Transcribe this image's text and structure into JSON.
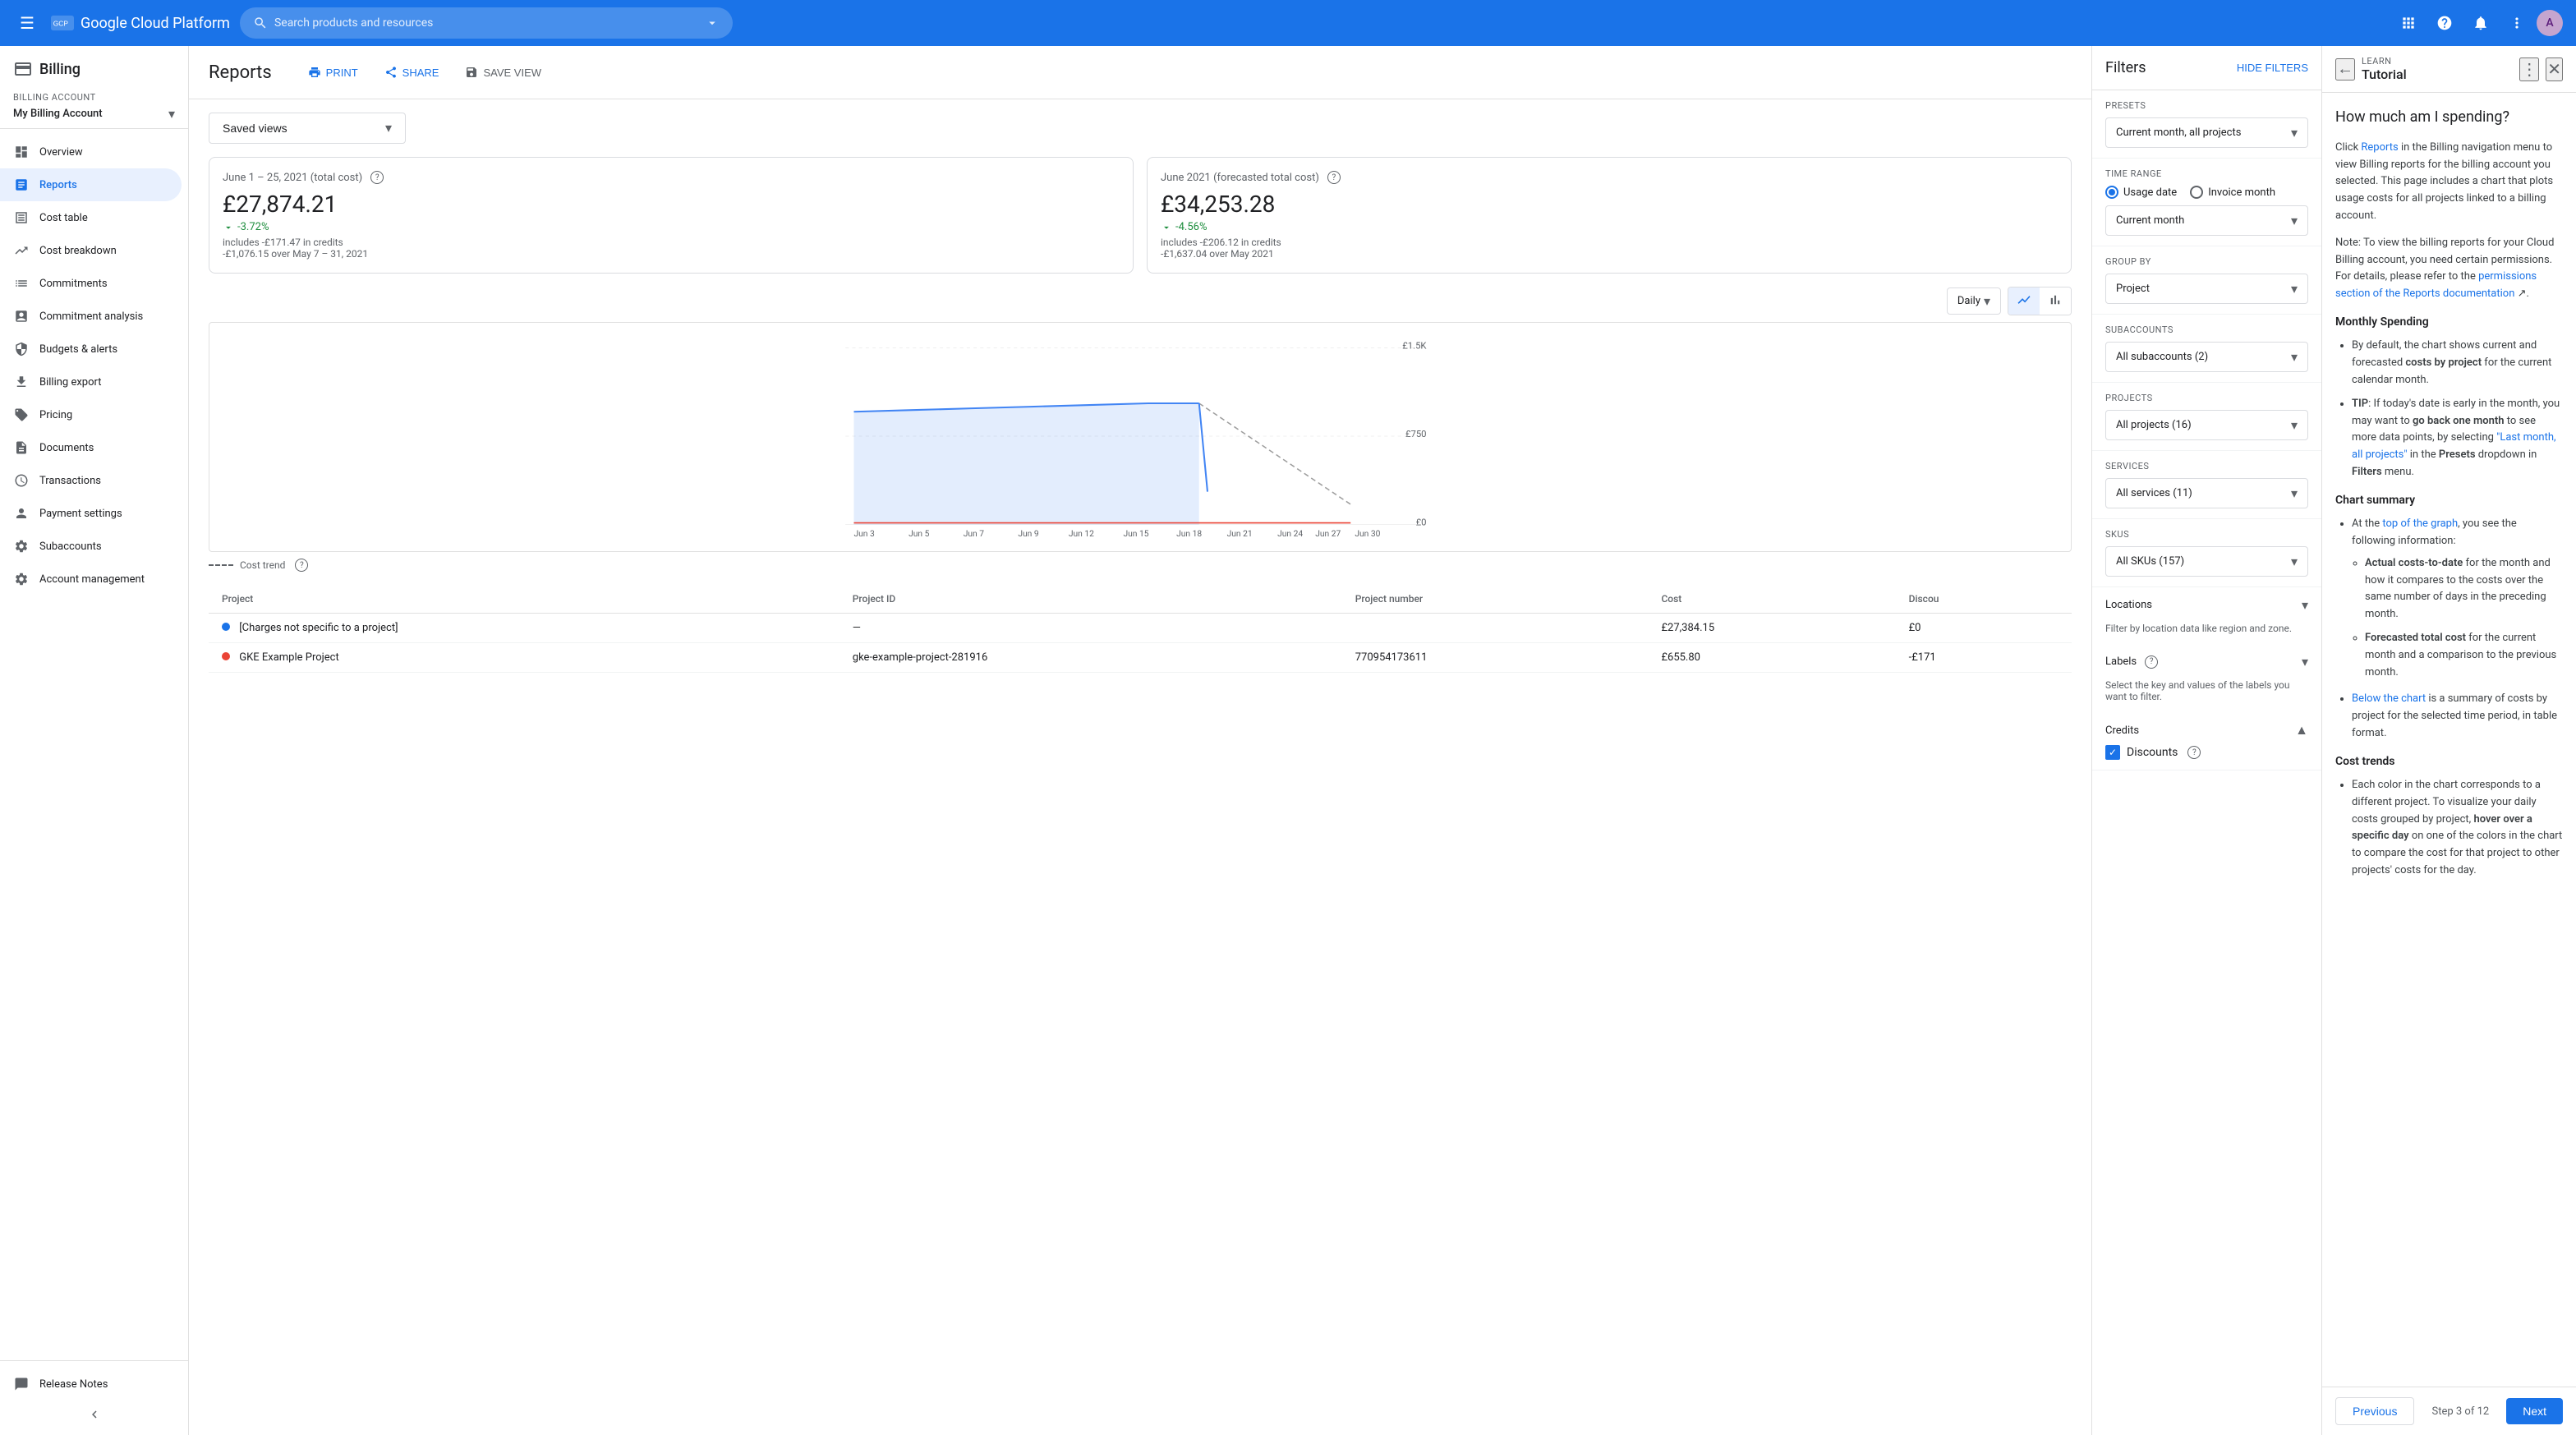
{
  "topnav": {
    "logo": "Google Cloud Platform",
    "search_placeholder": "Search products and resources"
  },
  "sidebar": {
    "billing_title": "Billing",
    "billing_account_label": "Billing account",
    "billing_account_name": "My Billing Account",
    "nav_items": [
      {
        "id": "overview",
        "label": "Overview",
        "icon": "⊞"
      },
      {
        "id": "reports",
        "label": "Reports",
        "icon": "📊",
        "active": true
      },
      {
        "id": "cost-table",
        "label": "Cost table",
        "icon": "⊟"
      },
      {
        "id": "cost-breakdown",
        "label": "Cost breakdown",
        "icon": "📉"
      },
      {
        "id": "commitments",
        "label": "Commitments",
        "icon": "≡"
      },
      {
        "id": "commitment-analysis",
        "label": "Commitment analysis",
        "icon": "📋"
      },
      {
        "id": "budgets-alerts",
        "label": "Budgets & alerts",
        "icon": "🔔"
      },
      {
        "id": "billing-export",
        "label": "Billing export",
        "icon": "⬆"
      },
      {
        "id": "pricing",
        "label": "Pricing",
        "icon": "🏷"
      },
      {
        "id": "documents",
        "label": "Documents",
        "icon": "📄"
      },
      {
        "id": "transactions",
        "label": "Transactions",
        "icon": "🕐"
      },
      {
        "id": "payment-settings",
        "label": "Payment settings",
        "icon": "👤"
      },
      {
        "id": "subaccounts",
        "label": "Subaccounts",
        "icon": "⚙"
      },
      {
        "id": "account-management",
        "label": "Account management",
        "icon": "⚙"
      }
    ],
    "footer_items": [
      {
        "id": "release-notes",
        "label": "Release Notes",
        "icon": "📝"
      }
    ]
  },
  "reports": {
    "title": "Reports",
    "print_label": "PRINT",
    "share_label": "SHARE",
    "save_view_label": "SAVE VIEW",
    "saved_views_placeholder": "Saved views",
    "date_range_label": "June 1 – 25, 2021 (total cost)",
    "date_range_amount": "£27,874.21",
    "date_range_change": "-3.72%",
    "date_range_credits": "includes -£171.47 in credits",
    "date_range_prev": "-£1,076.15 over May 7 – 31, 2021",
    "forecast_label": "June 2021 (forecasted total cost)",
    "forecast_amount": "£34,253.28",
    "forecast_change": "-4.56%",
    "forecast_credits": "includes -£206.12 in credits",
    "forecast_prev": "-£1,637.04 over May 2021",
    "chart_period": "Daily",
    "cost_trend_label": "Cost trend",
    "chart_labels": [
      "Jun 3",
      "Jun 5",
      "Jun 7",
      "Jun 9",
      "Jun 12",
      "Jun 15",
      "Jun 18",
      "Jun 21",
      "Jun 24",
      "Jun 27",
      "Jun 30"
    ],
    "chart_y_labels": [
      "£1.5K",
      "£750",
      "£0"
    ],
    "table_headers": [
      "Project",
      "Project ID",
      "Project number",
      "Cost",
      "Discou"
    ],
    "table_rows": [
      {
        "name": "[Charges not specific to a project]",
        "id": "—",
        "number": "",
        "cost": "£27,384.15",
        "discount": "£0",
        "color": "#1a73e8"
      },
      {
        "name": "GKE Example Project",
        "id": "gke-example-project-281916",
        "number": "770954173611",
        "cost": "£655.80",
        "discount": "-£171",
        "color": "#ea4335"
      }
    ]
  },
  "filters": {
    "title": "Filters",
    "hide_filters_label": "HIDE FILTERS",
    "presets_label": "Presets",
    "presets_value": "Current month, all projects",
    "time_range_label": "Time range",
    "usage_date_label": "Usage date",
    "invoice_month_label": "Invoice month",
    "time_range_value": "Current month",
    "group_by_label": "Group by",
    "group_by_value": "Project",
    "subaccounts_label": "Subaccounts",
    "subaccounts_value": "All subaccounts (2)",
    "projects_label": "Projects",
    "projects_value": "All projects (16)",
    "services_label": "Services",
    "services_value": "All services (11)",
    "skus_label": "SKUs",
    "skus_value": "All SKUs (157)",
    "locations_label": "Locations",
    "locations_desc": "Filter by location data like region and zone.",
    "labels_label": "Labels",
    "labels_desc": "Select the key and values of the labels you want to filter.",
    "credits_label": "Credits",
    "discounts_label": "Discounts"
  },
  "tutorial": {
    "learn_label": "LEARN",
    "title": "Tutorial",
    "heading": "How much am I spending?",
    "para1": "Click Reports in the Billing navigation menu to view Billing reports for the billing account you selected. This page includes a chart that plots usage costs for all projects linked to a billing account.",
    "para2": "Note: To view the billing reports for your Cloud Billing account, you need certain permissions. For details, please refer to the permissions section of the Reports documentation.",
    "monthly_spending_title": "Monthly Spending",
    "bullet1": "By default, the chart shows current and forecasted costs by project for the current calendar month.",
    "bullet2": "TIP: If today's date is early in the month, you may want to go back one month to see more data points, by selecting \"Last month, all projects\" in the Presets dropdown in Filters menu.",
    "chart_summary_title": "Chart summary",
    "chart_summary_bullet1": "At the top of the graph, you see the following information:",
    "chart_summary_sub1": "Actual costs-to-date for the month and how it compares to the costs over the same number of days in the preceding month.",
    "chart_summary_sub2": "Forecasted total cost for the current month and a comparison to the previous month.",
    "chart_summary_bullet2": "Below the chart is a summary of costs by project for the selected time period, in table format.",
    "cost_trends_title": "Cost trends",
    "cost_trends_bullet1": "Each color in the chart corresponds to a different project. To visualize your daily costs grouped by project, hover over a specific day on one of the colors in the chart to compare the cost for that project to other projects' costs for the day.",
    "prev_label": "Previous",
    "step_label": "Step 3 of 12",
    "next_label": "Next"
  }
}
